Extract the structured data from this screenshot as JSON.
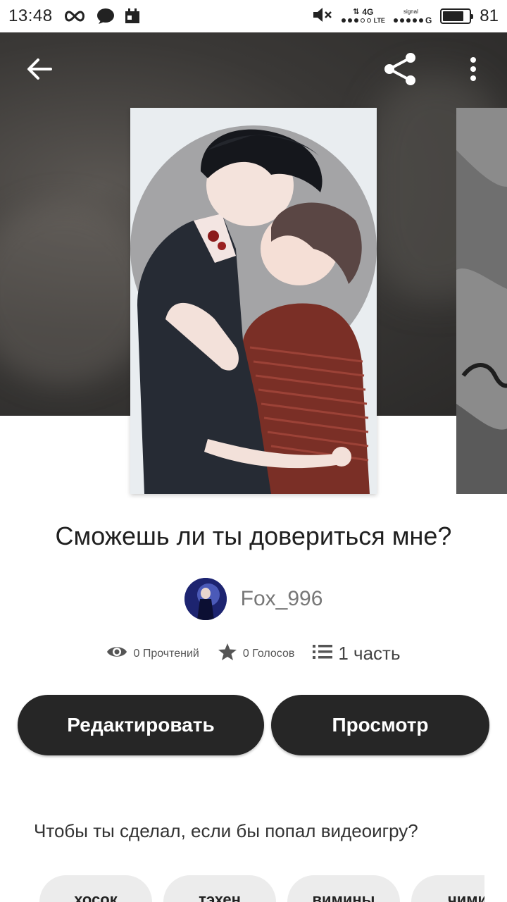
{
  "status_bar": {
    "time": "13:48",
    "battery": "81",
    "battery_level": 0.81,
    "network_1": "4G",
    "network_1_sub": "LTE",
    "network_2": "G",
    "signal_label": "signal",
    "icons": [
      "infinity-icon",
      "chat-icon",
      "calendar-icon",
      "mute-icon",
      "data-arrows-icon",
      "signal-icon",
      "battery-icon"
    ]
  },
  "header": {
    "back_icon": "arrow-left-icon",
    "share_icon": "share-icon",
    "more_icon": "more-vertical-icon"
  },
  "story": {
    "title": "Сможешь ли ты довериться мне?",
    "author": "Fox_996",
    "description": "Чтобы ты сделал, если бы попал видеоигру?"
  },
  "stats": {
    "reads": "0 Прочтений",
    "votes": "0 Голосов",
    "parts": "1 часть"
  },
  "actions": {
    "edit_label": "Редактировать",
    "view_label": "Просмотр"
  },
  "tags": [
    "хосок",
    "тэхен",
    "вимины",
    "чими"
  ],
  "colors": {
    "button_bg": "#262626",
    "button_text": "#ffffff",
    "tag_bg": "#ececec",
    "hero_bg": "#3a3836"
  }
}
